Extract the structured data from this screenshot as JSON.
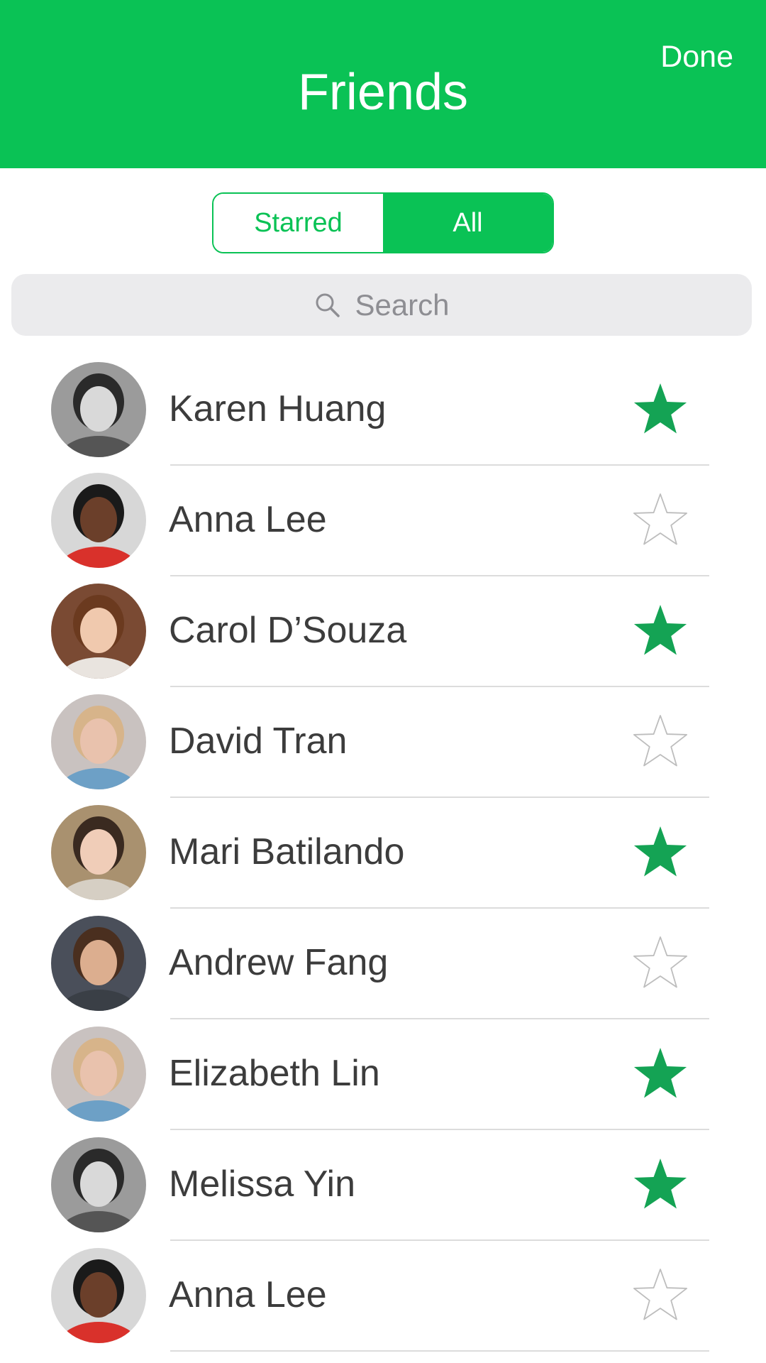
{
  "nav": {
    "title": "Friends",
    "done_label": "Done"
  },
  "segment": {
    "options": [
      "Starred",
      "All"
    ],
    "selected": "All"
  },
  "search": {
    "placeholder": "Search",
    "icon": "search-icon"
  },
  "colors": {
    "brand": "#0ac255",
    "star_filled": "#14a354",
    "star_outline": "#bdbdbd"
  },
  "friends": [
    {
      "name": "Karen Huang",
      "starred": true,
      "avatar_bg": "#9b9b9b",
      "avatar_skin": "#d9d9d9",
      "avatar_hair": "#2a2a2a",
      "avatar_shirt": "#555555"
    },
    {
      "name": "Anna Lee",
      "starred": false,
      "avatar_bg": "#d7d7d7",
      "avatar_skin": "#6b3f2a",
      "avatar_hair": "#1a1a1a",
      "avatar_shirt": "#d9312b"
    },
    {
      "name": "Carol D’Souza",
      "starred": true,
      "avatar_bg": "#7a4a33",
      "avatar_skin": "#f0c9ae",
      "avatar_hair": "#6b3a1f",
      "avatar_shirt": "#e9e4df"
    },
    {
      "name": "David Tran",
      "starred": false,
      "avatar_bg": "#c9c2c0",
      "avatar_skin": "#e9c2ad",
      "avatar_hair": "#d7b48a",
      "avatar_shirt": "#6da0c6"
    },
    {
      "name": "Mari Batilando",
      "starred": true,
      "avatar_bg": "#a9916f",
      "avatar_skin": "#f0cdb8",
      "avatar_hair": "#3a2a20",
      "avatar_shirt": "#d6cfc4"
    },
    {
      "name": "Andrew Fang",
      "starred": false,
      "avatar_bg": "#4a4f5a",
      "avatar_skin": "#dcae8f",
      "avatar_hair": "#4a2f1f",
      "avatar_shirt": "#3a3f46"
    },
    {
      "name": "Elizabeth Lin",
      "starred": true,
      "avatar_bg": "#c9c2c0",
      "avatar_skin": "#e9c2ad",
      "avatar_hair": "#d7b48a",
      "avatar_shirt": "#6da0c6"
    },
    {
      "name": "Melissa Yin",
      "starred": true,
      "avatar_bg": "#9b9b9b",
      "avatar_skin": "#d9d9d9",
      "avatar_hair": "#2a2a2a",
      "avatar_shirt": "#555555"
    },
    {
      "name": "Anna Lee",
      "starred": false,
      "avatar_bg": "#d7d7d7",
      "avatar_skin": "#6b3f2a",
      "avatar_hair": "#1a1a1a",
      "avatar_shirt": "#d9312b"
    }
  ]
}
